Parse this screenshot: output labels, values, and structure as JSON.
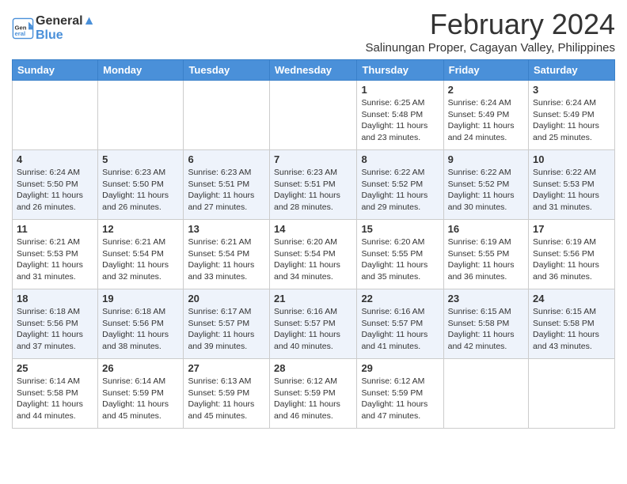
{
  "logo": {
    "line1": "General",
    "line2": "Blue"
  },
  "title": "February 2024",
  "subtitle": "Salinungan Proper, Cagayan Valley, Philippines",
  "days_of_week": [
    "Sunday",
    "Monday",
    "Tuesday",
    "Wednesday",
    "Thursday",
    "Friday",
    "Saturday"
  ],
  "weeks": [
    [
      {
        "day": "",
        "info": ""
      },
      {
        "day": "",
        "info": ""
      },
      {
        "day": "",
        "info": ""
      },
      {
        "day": "",
        "info": ""
      },
      {
        "day": "1",
        "info": "Sunrise: 6:25 AM\nSunset: 5:48 PM\nDaylight: 11 hours\nand 23 minutes."
      },
      {
        "day": "2",
        "info": "Sunrise: 6:24 AM\nSunset: 5:49 PM\nDaylight: 11 hours\nand 24 minutes."
      },
      {
        "day": "3",
        "info": "Sunrise: 6:24 AM\nSunset: 5:49 PM\nDaylight: 11 hours\nand 25 minutes."
      }
    ],
    [
      {
        "day": "4",
        "info": "Sunrise: 6:24 AM\nSunset: 5:50 PM\nDaylight: 11 hours\nand 26 minutes."
      },
      {
        "day": "5",
        "info": "Sunrise: 6:23 AM\nSunset: 5:50 PM\nDaylight: 11 hours\nand 26 minutes."
      },
      {
        "day": "6",
        "info": "Sunrise: 6:23 AM\nSunset: 5:51 PM\nDaylight: 11 hours\nand 27 minutes."
      },
      {
        "day": "7",
        "info": "Sunrise: 6:23 AM\nSunset: 5:51 PM\nDaylight: 11 hours\nand 28 minutes."
      },
      {
        "day": "8",
        "info": "Sunrise: 6:22 AM\nSunset: 5:52 PM\nDaylight: 11 hours\nand 29 minutes."
      },
      {
        "day": "9",
        "info": "Sunrise: 6:22 AM\nSunset: 5:52 PM\nDaylight: 11 hours\nand 30 minutes."
      },
      {
        "day": "10",
        "info": "Sunrise: 6:22 AM\nSunset: 5:53 PM\nDaylight: 11 hours\nand 31 minutes."
      }
    ],
    [
      {
        "day": "11",
        "info": "Sunrise: 6:21 AM\nSunset: 5:53 PM\nDaylight: 11 hours\nand 31 minutes."
      },
      {
        "day": "12",
        "info": "Sunrise: 6:21 AM\nSunset: 5:54 PM\nDaylight: 11 hours\nand 32 minutes."
      },
      {
        "day": "13",
        "info": "Sunrise: 6:21 AM\nSunset: 5:54 PM\nDaylight: 11 hours\nand 33 minutes."
      },
      {
        "day": "14",
        "info": "Sunrise: 6:20 AM\nSunset: 5:54 PM\nDaylight: 11 hours\nand 34 minutes."
      },
      {
        "day": "15",
        "info": "Sunrise: 6:20 AM\nSunset: 5:55 PM\nDaylight: 11 hours\nand 35 minutes."
      },
      {
        "day": "16",
        "info": "Sunrise: 6:19 AM\nSunset: 5:55 PM\nDaylight: 11 hours\nand 36 minutes."
      },
      {
        "day": "17",
        "info": "Sunrise: 6:19 AM\nSunset: 5:56 PM\nDaylight: 11 hours\nand 36 minutes."
      }
    ],
    [
      {
        "day": "18",
        "info": "Sunrise: 6:18 AM\nSunset: 5:56 PM\nDaylight: 11 hours\nand 37 minutes."
      },
      {
        "day": "19",
        "info": "Sunrise: 6:18 AM\nSunset: 5:56 PM\nDaylight: 11 hours\nand 38 minutes."
      },
      {
        "day": "20",
        "info": "Sunrise: 6:17 AM\nSunset: 5:57 PM\nDaylight: 11 hours\nand 39 minutes."
      },
      {
        "day": "21",
        "info": "Sunrise: 6:16 AM\nSunset: 5:57 PM\nDaylight: 11 hours\nand 40 minutes."
      },
      {
        "day": "22",
        "info": "Sunrise: 6:16 AM\nSunset: 5:57 PM\nDaylight: 11 hours\nand 41 minutes."
      },
      {
        "day": "23",
        "info": "Sunrise: 6:15 AM\nSunset: 5:58 PM\nDaylight: 11 hours\nand 42 minutes."
      },
      {
        "day": "24",
        "info": "Sunrise: 6:15 AM\nSunset: 5:58 PM\nDaylight: 11 hours\nand 43 minutes."
      }
    ],
    [
      {
        "day": "25",
        "info": "Sunrise: 6:14 AM\nSunset: 5:58 PM\nDaylight: 11 hours\nand 44 minutes."
      },
      {
        "day": "26",
        "info": "Sunrise: 6:14 AM\nSunset: 5:59 PM\nDaylight: 11 hours\nand 45 minutes."
      },
      {
        "day": "27",
        "info": "Sunrise: 6:13 AM\nSunset: 5:59 PM\nDaylight: 11 hours\nand 45 minutes."
      },
      {
        "day": "28",
        "info": "Sunrise: 6:12 AM\nSunset: 5:59 PM\nDaylight: 11 hours\nand 46 minutes."
      },
      {
        "day": "29",
        "info": "Sunrise: 6:12 AM\nSunset: 5:59 PM\nDaylight: 11 hours\nand 47 minutes."
      },
      {
        "day": "",
        "info": ""
      },
      {
        "day": "",
        "info": ""
      }
    ]
  ]
}
